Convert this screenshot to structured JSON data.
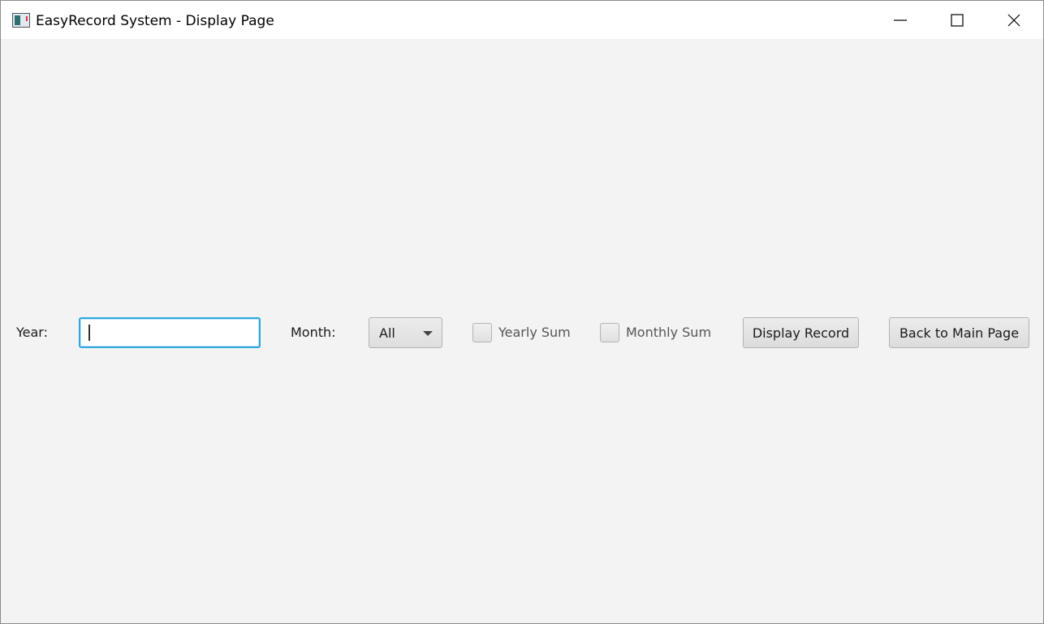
{
  "window": {
    "title": "EasyRecord System - Display Page"
  },
  "form": {
    "year_label": "Year:",
    "year_value": "",
    "month_label": "Month:",
    "month_selected": "All",
    "yearly_sum_label": "Yearly Sum",
    "yearly_sum_checked": false,
    "monthly_sum_label": "Monthly Sum",
    "monthly_sum_checked": false
  },
  "buttons": {
    "display_record": "Display Record",
    "back_to_main": "Back to Main Page"
  },
  "icons": {
    "minimize": "minimize-icon",
    "maximize": "maximize-icon",
    "close": "close-icon",
    "app": "app-icon",
    "dropdown": "chevron-down-icon"
  },
  "colors": {
    "focus_border": "#2ea7e0",
    "background": "#f3f3f3"
  }
}
